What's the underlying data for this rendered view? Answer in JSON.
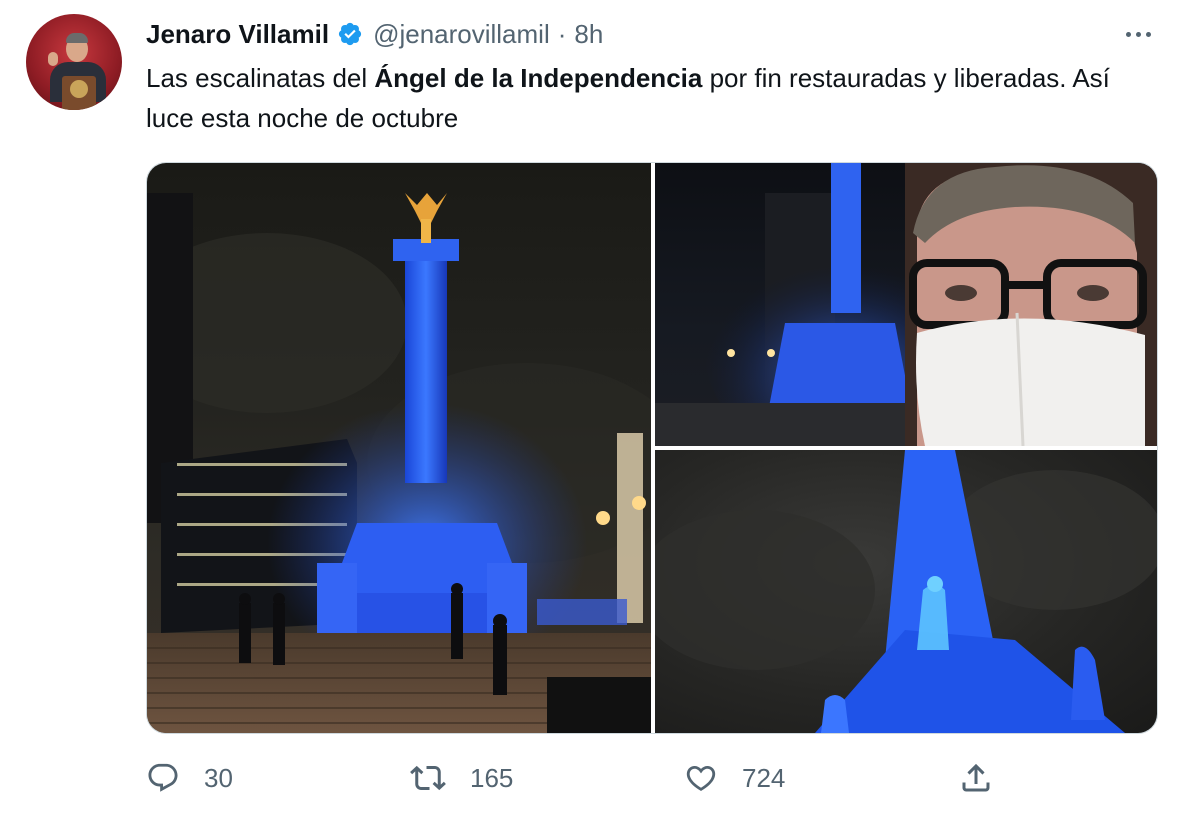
{
  "tweet": {
    "author": {
      "display_name": "Jenaro Villamil",
      "handle": "@jenarovillamil",
      "separator": "·",
      "time": "8h",
      "verified": true
    },
    "text": {
      "part1": "Las escalinatas del ",
      "bold": "Ángel de la Independencia",
      "part2": " por fin restauradas y liberadas. Así luce esta noche de octubre"
    },
    "media": [
      {
        "name": "photo-angel-monument-stairs",
        "icon": "photo"
      },
      {
        "name": "photo-monument-column-night",
        "icon": "photo"
      },
      {
        "name": "photo-statue-closeup",
        "icon": "photo"
      }
    ],
    "actions": {
      "reply_count": "30",
      "retweet_count": "165",
      "like_count": "724"
    }
  },
  "colors": {
    "text_primary": "#0f1419",
    "text_secondary": "#536471",
    "verified_blue": "#1d9bf0",
    "border": "#cfd9de",
    "monument_blue": "#1f5cff"
  }
}
